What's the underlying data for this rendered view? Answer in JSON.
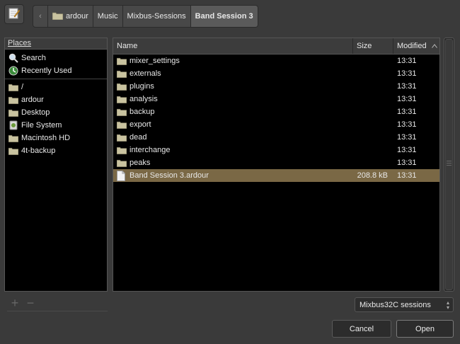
{
  "toolbar": {
    "edit_icon": "pencil-notepad-icon",
    "breadcrumbs": [
      {
        "label": "ardour",
        "icon": "folder-icon"
      },
      {
        "label": "Music"
      },
      {
        "label": "Mixbus-Sessions"
      },
      {
        "label": "Band Session 3"
      }
    ]
  },
  "places": {
    "header": "Places",
    "shortcuts": [
      {
        "label": "Search",
        "icon": "search-icon"
      },
      {
        "label": "Recently Used",
        "icon": "recent-icon"
      }
    ],
    "locations": [
      {
        "label": "/",
        "icon": "folder-icon"
      },
      {
        "label": "ardour",
        "icon": "folder-icon"
      },
      {
        "label": "Desktop",
        "icon": "folder-icon"
      },
      {
        "label": "File System",
        "icon": "filesystem-icon"
      },
      {
        "label": "Macintosh HD",
        "icon": "folder-icon"
      },
      {
        "label": "4t-backup",
        "icon": "folder-icon"
      }
    ],
    "add_label": "+",
    "remove_label": "−"
  },
  "file_list": {
    "columns": {
      "name": "Name",
      "size": "Size",
      "modified": "Modified"
    },
    "sort_indicator": "^",
    "rows": [
      {
        "name": "mixer_settings",
        "size": "",
        "modified": "13:31",
        "type": "folder"
      },
      {
        "name": "externals",
        "size": "",
        "modified": "13:31",
        "type": "folder"
      },
      {
        "name": "plugins",
        "size": "",
        "modified": "13:31",
        "type": "folder"
      },
      {
        "name": "analysis",
        "size": "",
        "modified": "13:31",
        "type": "folder"
      },
      {
        "name": "backup",
        "size": "",
        "modified": "13:31",
        "type": "folder"
      },
      {
        "name": "export",
        "size": "",
        "modified": "13:31",
        "type": "folder"
      },
      {
        "name": "dead",
        "size": "",
        "modified": "13:31",
        "type": "folder"
      },
      {
        "name": "interchange",
        "size": "",
        "modified": "13:31",
        "type": "folder"
      },
      {
        "name": "peaks",
        "size": "",
        "modified": "13:31",
        "type": "folder"
      },
      {
        "name": "Band Session 3.ardour",
        "size": "208.8 kB",
        "modified": "13:31",
        "type": "file",
        "selected": true
      }
    ]
  },
  "filter": {
    "selected": "Mixbus32C sessions"
  },
  "buttons": {
    "cancel": "Cancel",
    "open": "Open"
  },
  "colors": {
    "selection": "#7a6845",
    "list_bg": "#000000",
    "window_bg": "#3a3a3a"
  }
}
